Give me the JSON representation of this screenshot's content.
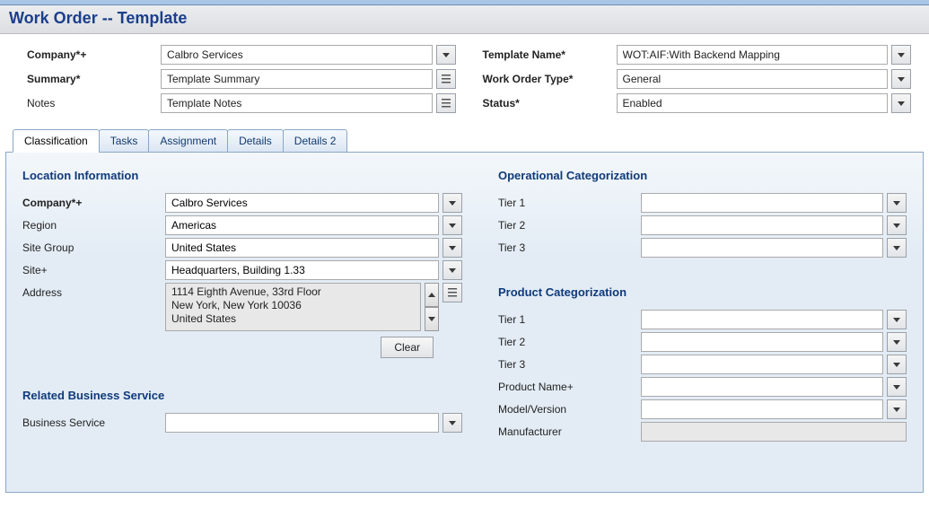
{
  "page_title": "Work Order -- Template",
  "header": {
    "company_label": "Company*+",
    "company_value": "Calbro Services",
    "summary_label": "Summary*",
    "summary_value": "Template Summary",
    "notes_label": "Notes",
    "notes_value": "Template Notes",
    "template_name_label": "Template Name*",
    "template_name_value": "WOT:AIF:With Backend Mapping",
    "wo_type_label": "Work Order Type*",
    "wo_type_value": "General",
    "status_label": "Status*",
    "status_value": "Enabled"
  },
  "tabs": {
    "t0": "Classification",
    "t1": "Tasks",
    "t2": "Assignment",
    "t3": "Details",
    "t4": "Details 2"
  },
  "loc": {
    "title": "Location Information",
    "company_label": "Company*+",
    "company_value": "Calbro Services",
    "region_label": "Region",
    "region_value": "Americas",
    "sitegroup_label": "Site Group",
    "sitegroup_value": "United States",
    "site_label": "Site+",
    "site_value": "Headquarters, Building 1.33",
    "address_label": "Address",
    "address_line1": "1114 Eighth Avenue, 33rd Floor",
    "address_line2": "New York, New York  10036",
    "address_line3": "United States",
    "clear_label": "Clear"
  },
  "related": {
    "title": "Related Business Service",
    "bs_label": "Business Service",
    "bs_value": ""
  },
  "opcat": {
    "title": "Operational Categorization",
    "t1_label": "Tier 1",
    "t1_value": "",
    "t2_label": "Tier 2",
    "t2_value": "",
    "t3_label": "Tier 3",
    "t3_value": ""
  },
  "prodcat": {
    "title": "Product Categorization",
    "t1_label": "Tier 1",
    "t1_value": "",
    "t2_label": "Tier 2",
    "t2_value": "",
    "t3_label": "Tier 3",
    "t3_value": "",
    "pname_label": "Product Name+",
    "pname_value": "",
    "model_label": "Model/Version",
    "model_value": "",
    "mfr_label": "Manufacturer",
    "mfr_value": ""
  }
}
